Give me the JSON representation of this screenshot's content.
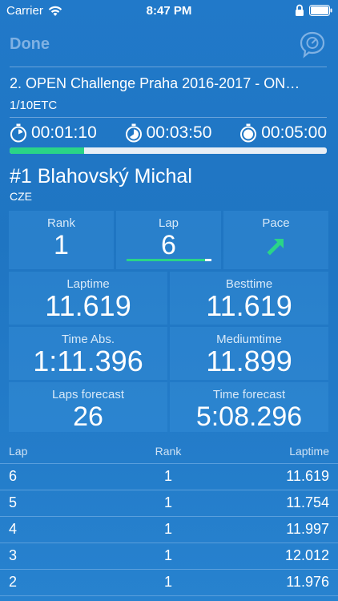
{
  "status_bar": {
    "carrier": "Carrier",
    "time": "8:47 PM"
  },
  "nav": {
    "done_label": "Done"
  },
  "event": {
    "title": "2. OPEN Challenge Praha 2016-2017 - ON…",
    "class": "1/10ETC"
  },
  "timers": {
    "elapsed": "00:01:10",
    "remaining": "00:03:50",
    "total": "00:05:00"
  },
  "progress_fraction": 0.235,
  "driver": {
    "name": "#1 Blahovský Michal",
    "country": "CZE"
  },
  "stats": {
    "rank_label": "Rank",
    "rank_value": "1",
    "lap_label": "Lap",
    "lap_value": "6",
    "pace_label": "Pace",
    "pace_icon": "arrow-up-right-icon",
    "laptime_label": "Laptime",
    "laptime_value": "11.619",
    "besttime_label": "Besttime",
    "besttime_value": "11.619",
    "timeabs_label": "Time Abs.",
    "timeabs_value": "1:11.396",
    "mediumtime_label": "Mediumtime",
    "mediumtime_value": "11.899",
    "lapsforecast_label": "Laps forecast",
    "lapsforecast_value": "26",
    "timeforecast_label": "Time forecast",
    "timeforecast_value": "5:08.296"
  },
  "colors": {
    "accent_green": "#2ad487",
    "background_blue": "#2179c9"
  },
  "table": {
    "headers": {
      "lap": "Lap",
      "rank": "Rank",
      "laptime": "Laptime"
    },
    "rows": [
      {
        "lap": "6",
        "rank": "1",
        "laptime": "11.619"
      },
      {
        "lap": "5",
        "rank": "1",
        "laptime": "11.754"
      },
      {
        "lap": "4",
        "rank": "1",
        "laptime": "11.997"
      },
      {
        "lap": "3",
        "rank": "1",
        "laptime": "12.012"
      },
      {
        "lap": "2",
        "rank": "1",
        "laptime": "11.976"
      }
    ]
  }
}
